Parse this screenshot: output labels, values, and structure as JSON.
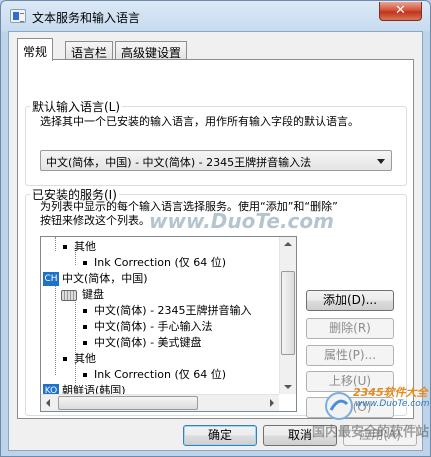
{
  "window": {
    "title": "文本服务和输入语言",
    "close_glyph": "✕"
  },
  "tabs": [
    {
      "label": "常规"
    },
    {
      "label": "语言栏"
    },
    {
      "label": "高级键设置"
    }
  ],
  "default_input": {
    "group_label": "默认输入语言(L)",
    "description": "选择其中一个已安装的输入语言，用作所有输入字段的默认语言。",
    "selected": "中文(简体，中国) - 中文(简体) - 2345王牌拼音输入法"
  },
  "installed_services": {
    "group_label": "已安装的服务(I)",
    "description_line1": "为列表中显示的每个输入语言选择服务。使用“添加”和“删除”",
    "description_line2": "按钮来修改这个列表。",
    "tree": {
      "row0": "其他",
      "row1": "Ink Correction (仅 64 位)",
      "row2_badge": "CH",
      "row2": "中文(简体，中国)",
      "row3": "键盘",
      "row4": "中文(简体) - 2345王牌拼音输入",
      "row5": "中文(简体) - 手心输入法",
      "row6": "中文(简体) - 美式键盘",
      "row7": "其他",
      "row8": "Ink Correction (仅 64 位)",
      "row9_badge": "KO",
      "row9": "朝鲜语(韩国)"
    },
    "buttons": {
      "add": "添加(D)...",
      "remove": "删除(R)",
      "properties": "属性(P)...",
      "move_up": "上移(U)",
      "move_down": "下移(O)"
    }
  },
  "footer": {
    "ok": "确定",
    "cancel": "取消",
    "apply": "应用(A)"
  },
  "watermarks": {
    "duote": "www.DuoTe.com",
    "brand": "2345软件大全",
    "url": "www.DuoTe.com",
    "cn": "国内最安全的软件站"
  }
}
